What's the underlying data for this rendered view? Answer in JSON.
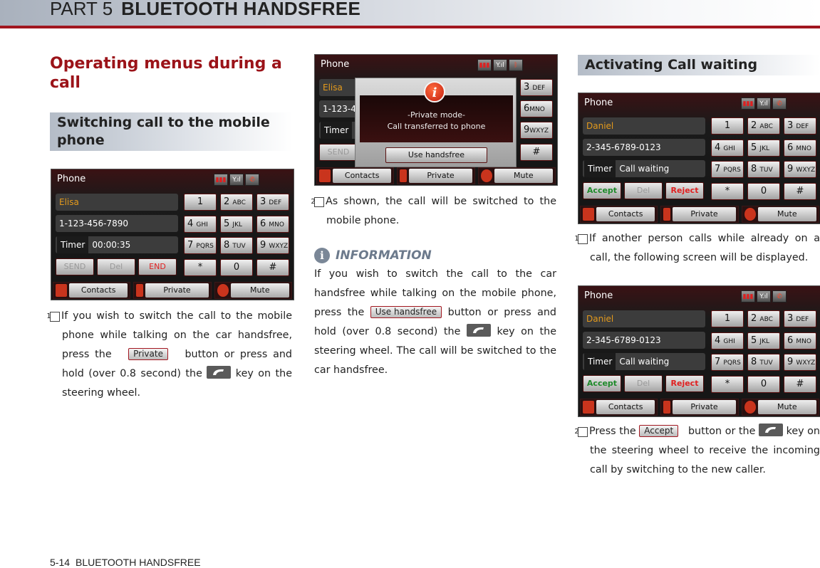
{
  "header": {
    "part": "PART 5",
    "title": "BLUETOOTH HANDSFREE"
  },
  "left": {
    "heading": "Operating menus during a call",
    "subheading": "Switching call to the mobile phone",
    "step1": {
      "num": "1",
      "text_a": "If you wish to switch the call to the mobile phone while talking on the car handsfree, press the",
      "button": "Private",
      "text_b": "button or press and hold (over 0.8 second) the",
      "text_c": "key on the steering wheel."
    }
  },
  "screen1": {
    "title": "Phone",
    "name": "Elisa",
    "number": "1-123-456-7890",
    "timer_label": "Timer",
    "timer_value": "00:00:35",
    "actions": [
      "SEND",
      "Del",
      "END"
    ],
    "keys": [
      {
        "d": "1",
        "l": ""
      },
      {
        "d": "2",
        "l": "ABC"
      },
      {
        "d": "3",
        "l": "DEF"
      },
      {
        "d": "4",
        "l": "GHI"
      },
      {
        "d": "5",
        "l": "JKL"
      },
      {
        "d": "6",
        "l": "MNO"
      },
      {
        "d": "7",
        "l": "PQRS"
      },
      {
        "d": "8",
        "l": "TUV"
      },
      {
        "d": "9",
        "l": "WXYZ"
      },
      {
        "d": "*",
        "l": ""
      },
      {
        "d": "0",
        "l": ""
      },
      {
        "d": "#",
        "l": ""
      }
    ],
    "bottom": [
      "Contacts",
      "Private",
      "Mute"
    ]
  },
  "middle": {
    "step2": {
      "num": "2",
      "text": "As shown, the call will be switched to the mobile phone."
    },
    "info": {
      "title": "INFORMATION",
      "text_a": "If you wish to switch the call to the car handsfree while talking on the mobile phone, press the",
      "button": "Use handsfree",
      "text_b": "button or press and hold (over 0.8 second) the",
      "text_c": "key on the steering wheel. The call will be switched to the car handsfree."
    }
  },
  "screen2": {
    "title": "Phone",
    "name": "Elisa",
    "number": "1-123-4",
    "timer_label": "Timer",
    "action": "SEND",
    "keys": [
      {
        "d": "3",
        "l": "DEF"
      },
      {
        "d": "6",
        "l": "MNO"
      },
      {
        "d": "9",
        "l": "WXYZ"
      },
      {
        "d": "#",
        "l": ""
      }
    ],
    "popup_line1": "-Private mode-",
    "popup_line2": "Call transferred to phone",
    "popup_button": "Use handsfree",
    "bottom": [
      "Contacts",
      "Private",
      "Mute"
    ]
  },
  "right": {
    "subheading": "Activating Call waiting",
    "step1": {
      "num": "1",
      "text": "If another person calls while already on a call, the following screen will be displayed."
    },
    "step2": {
      "num": "2",
      "text_a": "Press the",
      "button": "Accept",
      "text_b": "button or the",
      "text_c": "key on the steering wheel to receive the incoming call by switching to the new caller."
    }
  },
  "screen3": {
    "title": "Phone",
    "name": "Daniel",
    "number": "2-345-6789-0123",
    "timer_label": "Timer",
    "timer_value": "Call waiting",
    "actions": [
      "Accept",
      "Del",
      "Reject"
    ],
    "bottom": [
      "Contacts",
      "Private",
      "Mute"
    ]
  },
  "footer": {
    "page": "5-14",
    "section": "BLUETOOTH HANDSFREE"
  }
}
